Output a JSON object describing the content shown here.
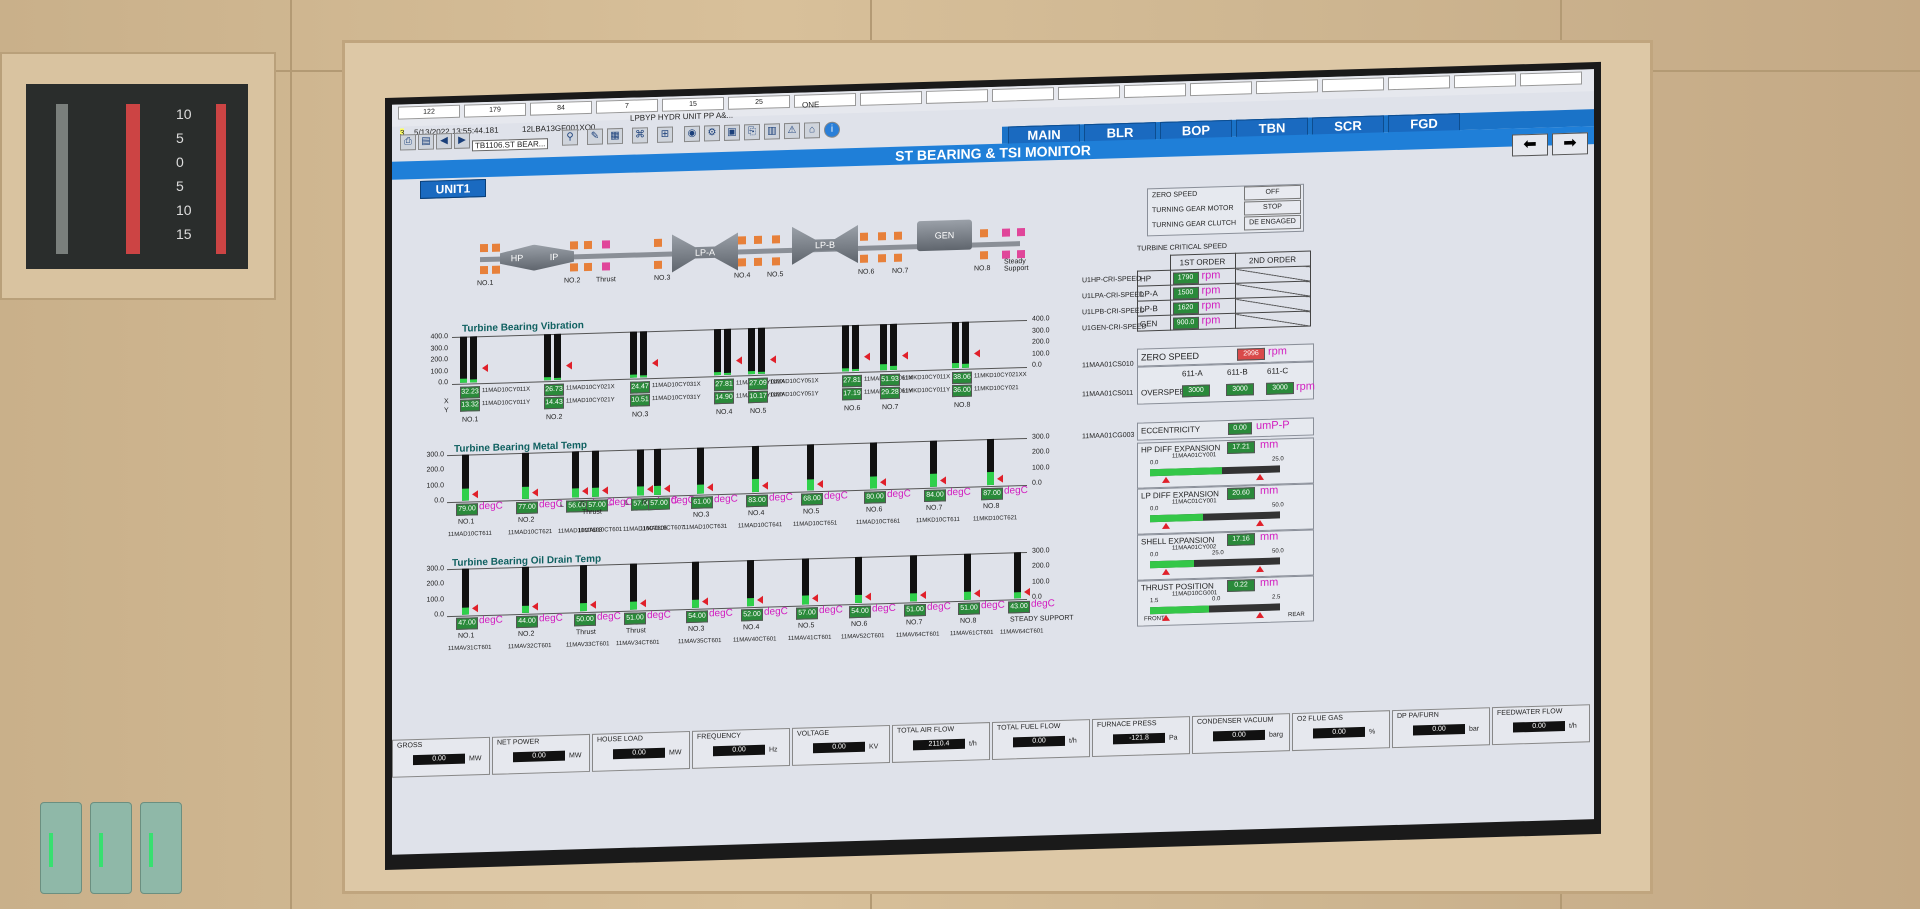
{
  "top_cells": [
    "122",
    "179",
    "84",
    "7",
    "15",
    "25",
    "",
    "",
    "",
    "",
    "",
    "",
    "",
    "",
    "",
    "",
    "",
    ""
  ],
  "info": {
    "counter": "3",
    "timestamp": "5/13/2022 13:55:44.181",
    "tag": "12LBA13GF001XQ0...",
    "alarm": "LPBYP HYDR UNIT PP A&...",
    "one": "ONE",
    "page_code": "TB1106.ST BEAR..."
  },
  "nav": [
    "MAIN",
    "BLR",
    "BOP",
    "TBN",
    "SCR",
    "FGD"
  ],
  "title": "ST BEARING & TSI MONITOR",
  "unit": "UNIT1",
  "schematic": {
    "sections": [
      "HP",
      "IP",
      "LP-A",
      "LP-B",
      "GEN"
    ],
    "bearings": [
      "NO.1",
      "NO.2",
      "Thrust",
      "NO.3",
      "NO.4",
      "NO.5",
      "NO.6",
      "NO.7",
      "NO.8",
      "Steady Support"
    ]
  },
  "vibration": {
    "title": "Turbine Bearing Vibration",
    "axis": [
      "400.0",
      "300.0",
      "200.0",
      "100.0",
      "0.0"
    ],
    "x_label": "X",
    "y_label": "Y",
    "groups": [
      {
        "name": "NO.1",
        "x": "32.23",
        "y": "13.32",
        "tx": "11MAD10CY011X",
        "ty": "11MAD10CY011Y",
        "fx": 0.08,
        "fy": 0.06
      },
      {
        "name": "NO.2",
        "x": "26.73",
        "y": "14.43",
        "tx": "11MAD10CY021X",
        "ty": "11MAD10CY021Y",
        "fx": 0.07,
        "fy": 0.05
      },
      {
        "name": "NO.3",
        "x": "24.47",
        "y": "10.51",
        "tx": "11MAD10CY031X",
        "ty": "11MAD10CY031Y",
        "fx": 0.06,
        "fy": 0.04
      },
      {
        "name": "NO.4",
        "x": "27.81",
        "y": "14.90",
        "tx": "11MAD10CY041X",
        "ty": "11MAD10CY041Y",
        "fx": 0.07,
        "fy": 0.05
      },
      {
        "name": "NO.5",
        "x": "27.09",
        "y": "10.17",
        "tx": "11MAD10CY051X",
        "ty": "11MAD10CY051Y",
        "fx": 0.07,
        "fy": 0.04
      },
      {
        "name": "NO.6",
        "x": "27.81",
        "y": "17.19",
        "tx": "11MAD10CY061X",
        "ty": "11MAD10CY061Y",
        "fx": 0.07,
        "fy": 0.05
      },
      {
        "name": "NO.7",
        "x": "51.93",
        "y": "29.28",
        "tx": "11MKD10CY011X",
        "ty": "11MKD10CY011Y",
        "fx": 0.13,
        "fy": 0.08
      },
      {
        "name": "NO.8",
        "x": "38.06",
        "y": "36.00",
        "tx": "11MKD10CY021XX",
        "ty": "11MKD10CY021",
        "fx": 0.1,
        "fy": 0.09
      }
    ]
  },
  "metal": {
    "title": "Turbine Bearing Metal Temp",
    "axis": [
      "300.0",
      "200.0",
      "100.0",
      "0.0"
    ],
    "unit": "degC",
    "items": [
      {
        "name": "NO.1",
        "v": "79.00",
        "tag": "11MAD10CT611",
        "f": 0.26
      },
      {
        "name": "NO.2",
        "v": "77.00",
        "tag": "11MAD10CT621",
        "f": 0.26
      },
      {
        "name": "",
        "v": "56.00",
        "tag": "11MAD10CT603",
        "f": 0.19,
        "pre": "L"
      },
      {
        "name": "",
        "v": "57.00",
        "tag": "11MAD10CT601",
        "f": 0.19,
        "pre": "R"
      },
      {
        "name": "",
        "v": "57.00",
        "tag": "11MAD10CT606",
        "f": 0.19,
        "pre": "L"
      },
      {
        "name": "",
        "v": "57.00",
        "tag": "11MAD10CT607",
        "f": 0.19,
        "pre": "R"
      },
      {
        "name": "NO.3",
        "v": "61.00",
        "tag": "11MAD10CT631",
        "f": 0.2
      },
      {
        "name": "NO.4",
        "v": "83.00",
        "tag": "11MAD10CT641",
        "f": 0.28
      },
      {
        "name": "NO.5",
        "v": "68.00",
        "tag": "11MAD10CT651",
        "f": 0.23
      },
      {
        "name": "NO.6",
        "v": "80.00",
        "tag": "11MAD10CT661",
        "f": 0.27
      },
      {
        "name": "NO.7",
        "v": "84.00",
        "tag": "11MKD10CT611",
        "f": 0.28
      },
      {
        "name": "NO.8",
        "v": "87.00",
        "tag": "11MKD10CT621",
        "f": 0.29
      }
    ],
    "group_labels": [
      "Thrust"
    ]
  },
  "oil": {
    "title": "Turbine Bearing Oil Drain Temp",
    "axis": [
      "300.0",
      "200.0",
      "100.0",
      "0.0"
    ],
    "unit": "degC",
    "items": [
      {
        "name": "NO.1",
        "v": "47.00",
        "tag": "11MAV31CT601",
        "f": 0.16
      },
      {
        "name": "NO.2",
        "v": "44.00",
        "tag": "11MAV32CT601",
        "f": 0.15
      },
      {
        "name": "Thrust",
        "v": "50.00",
        "tag": "11MAV33CT601",
        "f": 0.17
      },
      {
        "name": "Thrust",
        "v": "51.00",
        "tag": "11MAV34CT601",
        "f": 0.17
      },
      {
        "name": "NO.3",
        "v": "54.00",
        "tag": "11MAV35CT601",
        "f": 0.18
      },
      {
        "name": "NO.4",
        "v": "52.00",
        "tag": "11MAV40CT601",
        "f": 0.17
      },
      {
        "name": "NO.5",
        "v": "57.00",
        "tag": "11MAV41CT601",
        "f": 0.19
      },
      {
        "name": "NO.6",
        "v": "54.00",
        "tag": "11MAV52CT601",
        "f": 0.18
      },
      {
        "name": "NO.7",
        "v": "51.00",
        "tag": "11MAV64CT601",
        "f": 0.17
      },
      {
        "name": "NO.8",
        "v": "51.00",
        "tag": "11MAV61CT601",
        "f": 0.17
      },
      {
        "name": "STEADY SUPPORT",
        "v": "43.00",
        "tag": "11MAV64CT601",
        "f": 0.14
      }
    ]
  },
  "status": {
    "zero_speed_label": "ZERO SPEED",
    "zero_speed": "OFF",
    "turning_motor_label": "TURNING GEAR MOTOR",
    "turning_motor": "STOP",
    "turning_clutch_label": "TURNING GEAR CLUTCH",
    "turning_clutch": "DE ENGAGED"
  },
  "critical": {
    "title": "TURBINE CRITICAL SPEED",
    "h1": "1ST ORDER",
    "h2": "2ND ORDER",
    "rows": [
      {
        "tag": "U1HP-CRI-SPEED",
        "name": "HP",
        "v": "1790",
        "u": "rpm"
      },
      {
        "tag": "U1LPA-CRI-SPEED",
        "name": "LP-A",
        "v": "1500",
        "u": "rpm"
      },
      {
        "tag": "U1LPB-CRI-SPEED",
        "name": "LP-B",
        "v": "1620",
        "u": "rpm"
      },
      {
        "tag": "U1GEN-CRI-SPEED",
        "name": "GEN",
        "v": "900.0",
        "u": "rpm"
      }
    ]
  },
  "speed": {
    "zero_tag": "11MAA01CS010",
    "zero_label": "ZERO SPEED",
    "zero_v": "2996",
    "unit": "rpm",
    "over_tag": "11MAA01CS011",
    "over_label": "OVERSPEED",
    "cols": [
      "611-A",
      "611-B",
      "611-C"
    ],
    "vals": [
      "3000",
      "3000",
      "3000"
    ]
  },
  "ecc": {
    "tag": "11MAA01CG003",
    "label": "ECCENTRICITY",
    "v": "0.00",
    "u": "umP-P"
  },
  "expansions": [
    {
      "label": "HP DIFF EXPANSION",
      "v": "17.21",
      "u": "mm",
      "tag": "11MAA01CY001",
      "min": "0.0",
      "max": "25.0",
      "fill": 0.55
    },
    {
      "label": "LP DIFF EXPANSION",
      "v": "20.60",
      "u": "mm",
      "tag": "11MAC01CY001",
      "min": "0.0",
      "max": "50.0",
      "fill": 0.41
    },
    {
      "label": "SHELL EXPANSION",
      "v": "17.16",
      "u": "mm",
      "tag": "11MAA01CY002",
      "min": "0.0",
      "mid": "25.0",
      "max": "50.0",
      "fill": 0.34
    },
    {
      "label": "THRUST POSITION",
      "v": "0.22",
      "u": "mm",
      "tag": "11MAD10CG001",
      "min": "1.5",
      "mid": "0.0",
      "max": "2.5",
      "fill": 0.45,
      "left": "FRONT",
      "right": "REAR"
    }
  ],
  "bottom": [
    {
      "l": "GROSS",
      "v": "0.00",
      "u": "MW"
    },
    {
      "l": "NET POWER",
      "v": "0.00",
      "u": "MW"
    },
    {
      "l": "HOUSE LOAD",
      "v": "0.00",
      "u": "MW"
    },
    {
      "l": "FREQUENCY",
      "v": "0.00",
      "u": "Hz"
    },
    {
      "l": "VOLTAGE",
      "v": "0.00",
      "u": "KV"
    },
    {
      "l": "TOTAL AIR FLOW",
      "v": "2110.4",
      "u": "t/h"
    },
    {
      "l": "TOTAL FUEL FLOW",
      "v": "0.00",
      "u": "t/h"
    },
    {
      "l": "FURNACE PRESS",
      "v": "-121.8",
      "u": "Pa"
    },
    {
      "l": "CONDENSER VACUUM",
      "v": "0.00",
      "u": "barg"
    },
    {
      "l": "O2 FLUE GAS",
      "v": "0.00",
      "u": "%"
    },
    {
      "l": "DP PA/FURN",
      "v": "0.00",
      "u": "bar"
    },
    {
      "l": "FEEDWATER FLOW",
      "v": "0.00",
      "u": "t/h"
    }
  ],
  "mini_scale": [
    "10",
    "5",
    "0",
    "5",
    "10",
    "15"
  ]
}
